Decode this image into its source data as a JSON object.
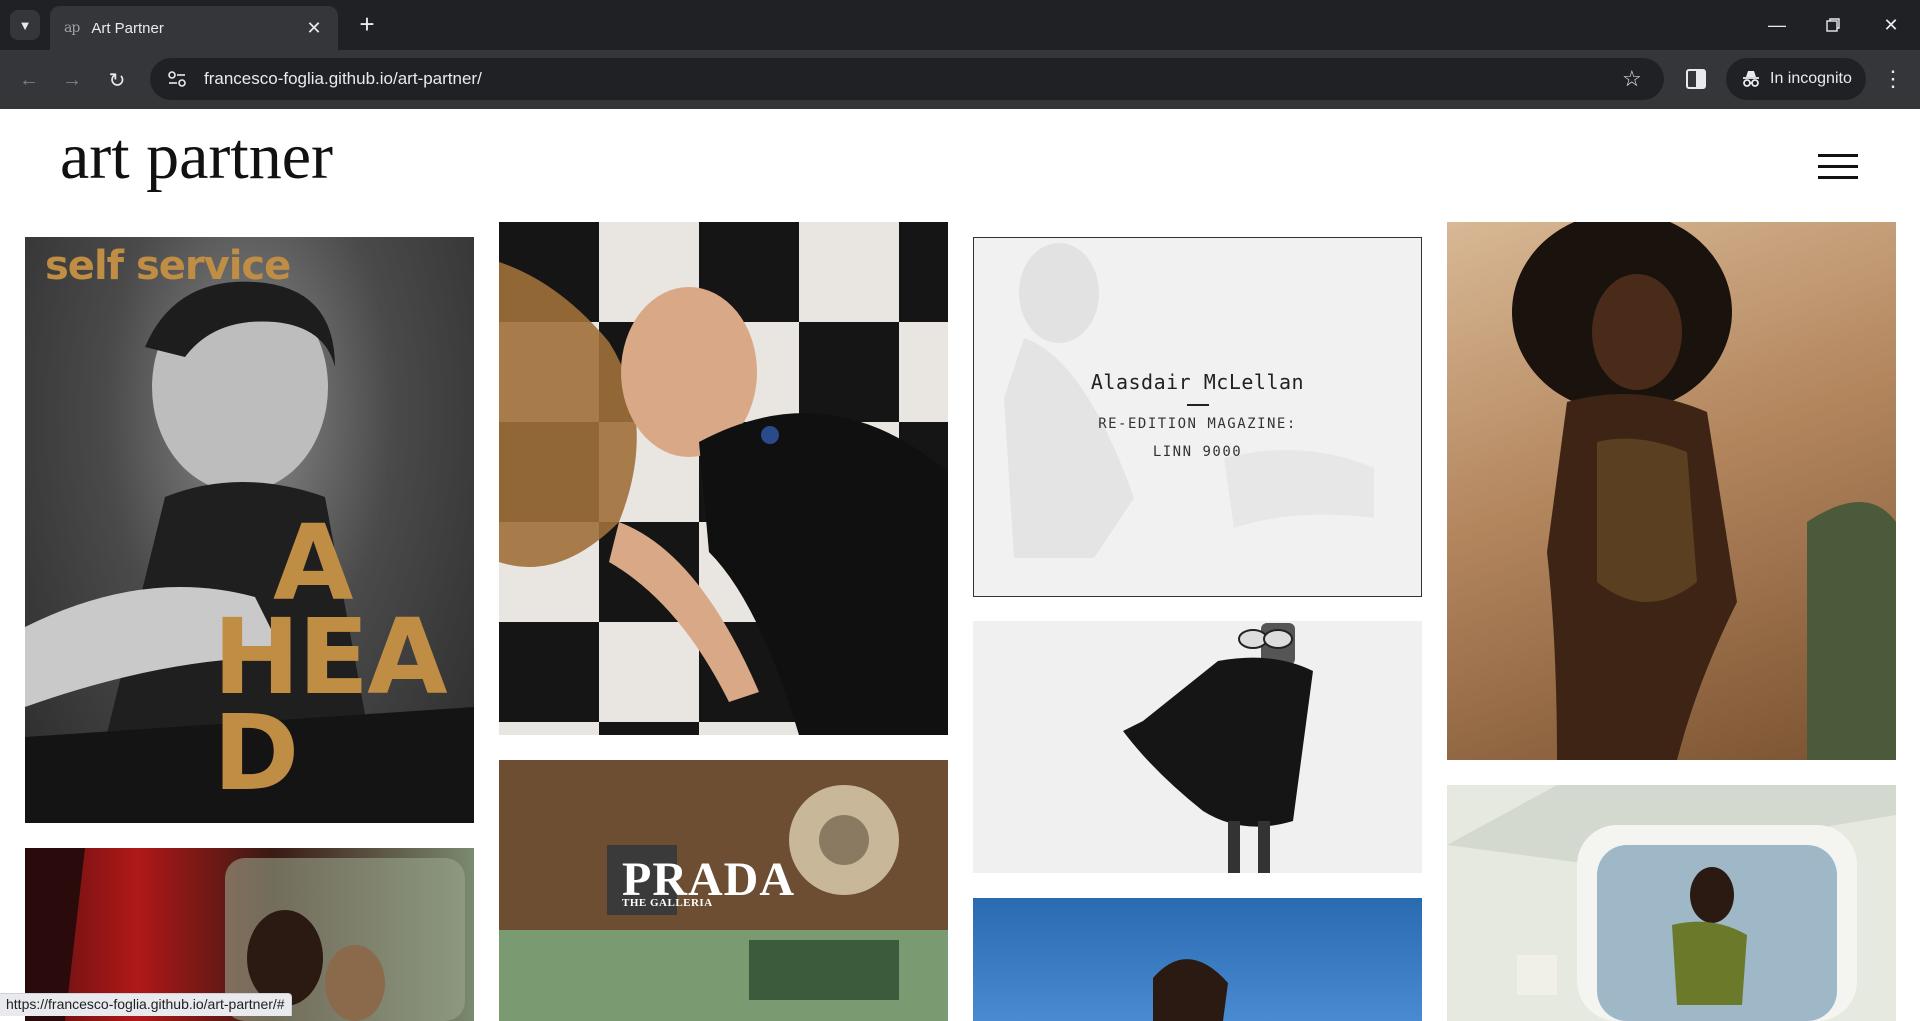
{
  "browser": {
    "tab_title": "Art Partner",
    "tab_favicon_text": "ap",
    "url": "francesco-foglia.github.io/art-partner/",
    "incognito_label": "In incognito",
    "status_url": "https://francesco-foglia.github.io/art-partner/#"
  },
  "site": {
    "logo": "art partner"
  },
  "tiles": {
    "self_service": {
      "brand": "self service",
      "line1": "A",
      "line2": "HEA",
      "line3": "D"
    },
    "mclellan": {
      "name": "Alasdair McLellan",
      "line1": "RE-EDITION MAGAZINE:",
      "line2": "LINN 9000"
    },
    "prada": {
      "brand": "PRADA",
      "sub": "THE GALLERIA"
    }
  },
  "colors": {
    "chrome_dark": "#202124",
    "chrome_mid": "#35363a",
    "accent_gold": "#c08d45"
  }
}
